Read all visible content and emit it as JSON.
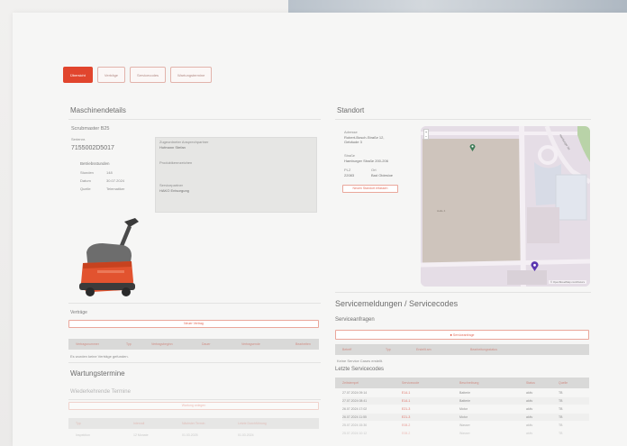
{
  "tabs": [
    "Übersicht",
    "Verträge",
    "Servicecodes",
    "Wartungstermine"
  ],
  "details": {
    "title": "Maschinendetails",
    "model": "Scrubmaster B25",
    "serial_label": "Seriennr.",
    "serial": "7155002D5017",
    "operating_hours_label": "Betriebsstunden",
    "hours_rows": [
      {
        "label": "Stunden",
        "value": "148"
      },
      {
        "label": "Datum",
        "value": "30.07.2024"
      },
      {
        "label": "Quelle",
        "value": "Telematiker"
      }
    ],
    "box_fields": [
      {
        "label": "Zugeordneter Ansprechpartner",
        "value": "Hofmann Stefan"
      },
      {
        "label": "Produktkennzeichen",
        "value": ""
      },
      {
        "label": "Servicepartner",
        "value": "HAKO Entsorgung"
      }
    ]
  },
  "location": {
    "title": "Standort",
    "address_label": "Adresse",
    "address": "Robert-Bosch-Straße 12, Gebäude 3",
    "street_label": "Straße",
    "street": "Hamburger Straße 200-206",
    "plz_label": "PLZ",
    "plz": "22083",
    "city_label": "Ort",
    "city": "Bad Oldesloe",
    "action": "Neuen Standort erfassen"
  },
  "contracts": {
    "title": "Verträge",
    "button": "Neuer Vertrag",
    "columns": [
      "Vertragsnummer",
      "Typ",
      "Vertragsbeginn",
      "Dauer",
      "Vertragsende",
      "Bearbeiten"
    ],
    "empty": "Es wurden keine Verträge gefunden."
  },
  "maintenance": {
    "title": "Wartungstermine",
    "subtitle": "Wiederkehrende Termine",
    "button": "Wartung anlegen",
    "columns": [
      "Typ",
      "Intervall",
      "Nächster Termin",
      "Letzte Durchführung"
    ],
    "row": [
      "Inspektion",
      "12 Monate",
      "01.03.2025",
      "01.03.2024"
    ]
  },
  "service": {
    "title": "Servicemeldungen / Servicecodes",
    "requests_title": "Serviceanfragen",
    "request_button": "Serviceanfrage",
    "request_columns": [
      "Betreff",
      "Typ",
      "Erstellt am",
      "Bearbeitungsstatus"
    ],
    "request_empty": "Keine Service Cases erstellt.",
    "codes_title": "Letzte Servicecodes",
    "code_columns": [
      "Zeitstempel",
      "Servicecode",
      "Beschreibung",
      "Status",
      "Quelle"
    ],
    "code_rows": [
      [
        "27.07.2024 09:14",
        "E14-1",
        "Batterie",
        "aktiv",
        "TB"
      ],
      [
        "27.07.2024 08:41",
        "E14-1",
        "Batterie",
        "aktiv",
        "TB"
      ],
      [
        "26.07.2024 17:02",
        "E21-3",
        "Motor",
        "aktiv",
        "TB"
      ],
      [
        "26.07.2024 11:55",
        "E21-3",
        "Motor",
        "aktiv",
        "TB"
      ],
      [
        "25.07.2024 15:30",
        "E08-2",
        "Wasser",
        "aktiv",
        "TB"
      ],
      [
        "25.07.2024 10:12",
        "E08-2",
        "Wasser",
        "aktiv",
        "TB"
      ]
    ]
  },
  "map": {
    "attribution": "© OpenStreetMap contributors",
    "road_label": "Hamburger Str.",
    "building_label": "Halle 4"
  },
  "colors": {
    "accent": "#e1452d",
    "muted_red": "#e0746a",
    "header_grey": "#d9d9d8",
    "map_bg": "#e5dde6",
    "map_green": "#3b7a55",
    "map_purple": "#5b36b0"
  }
}
